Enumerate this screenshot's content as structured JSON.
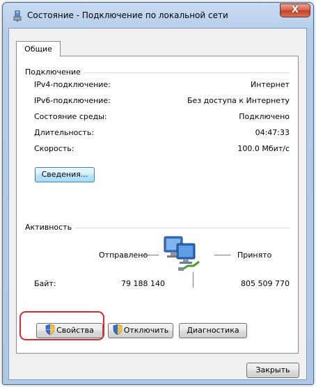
{
  "window": {
    "title": "Состояние - Подключение по локальной сети",
    "close_glyph": "X",
    "tab_label": "Общие"
  },
  "connection": {
    "group_label": "Подключение",
    "rows": [
      {
        "label": "IPv4-подключение:",
        "value": "Интернет"
      },
      {
        "label": "IPv6-подключение:",
        "value": "Без доступа к Интернету"
      },
      {
        "label": "Состояние среды:",
        "value": "Подключено"
      },
      {
        "label": "Длительность:",
        "value": "04:47:33"
      },
      {
        "label": "Скорость:",
        "value": "100.0 Мбит/с"
      }
    ],
    "details_button": "Сведения..."
  },
  "activity": {
    "group_label": "Активность",
    "sent_label": "Отправлено",
    "received_label": "Принято",
    "bytes_label": "Байт:",
    "bytes_sent": "79 188 140",
    "bytes_received": "805 509 770",
    "icon": "network-computers-icon"
  },
  "buttons": {
    "properties": "Свойства",
    "disable": "Отключить",
    "diagnose": "Диагностика",
    "close": "Закрыть"
  },
  "colors": {
    "highlight": "#e0262e",
    "title_bar": "#b6cde9",
    "close_button": "#c2402a"
  }
}
